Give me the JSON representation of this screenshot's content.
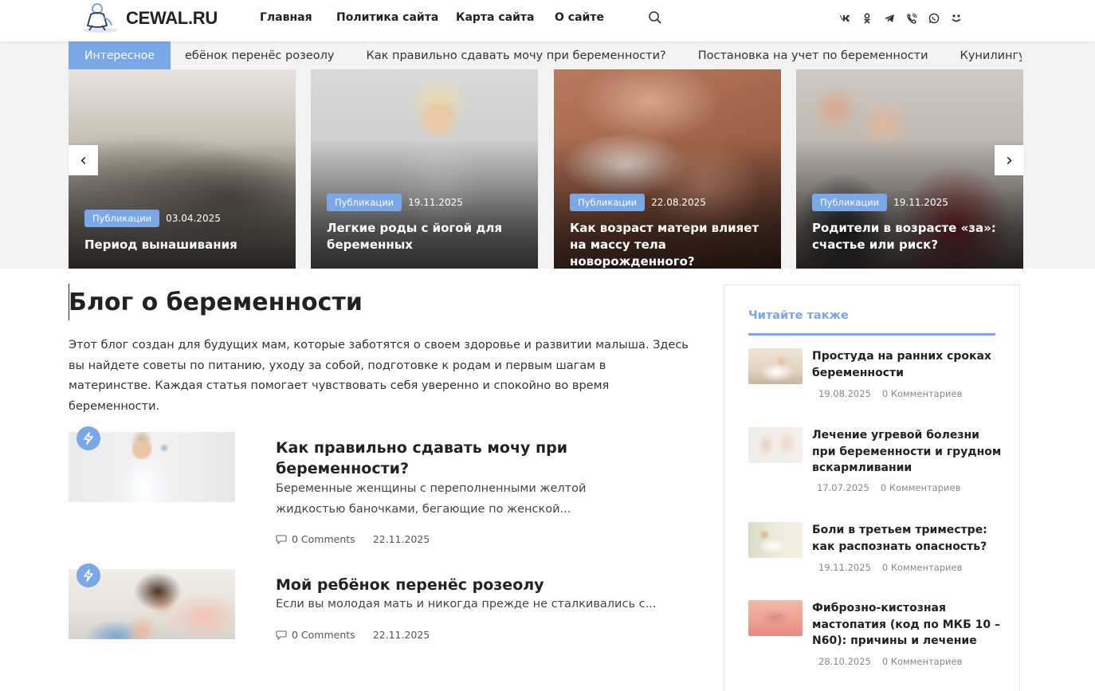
{
  "header": {
    "logo_text": "CEWAL.RU",
    "nav": [
      "Главная",
      "Политика сайта",
      "Карта сайта",
      "О сайте"
    ],
    "social_icons": [
      "vk-icon",
      "odnoklassniki-icon",
      "telegram-icon",
      "viber-icon",
      "whatsapp-icon",
      "moimir-icon"
    ]
  },
  "ticker": {
    "label": "Интересное",
    "items": [
      "ебёнок перенёс розеолу",
      "Как правильно сдавать мочу при беременности?",
      "Постановка на учет по беременности",
      "Кунилингус во"
    ]
  },
  "slider": {
    "cards": [
      {
        "badge": "Публикации",
        "date": "03.04.2025",
        "title": "Период вынашивания"
      },
      {
        "badge": "Публикации",
        "date": "19.11.2025",
        "title": "Легкие роды с йогой для беременных"
      },
      {
        "badge": "Публикации",
        "date": "22.08.2025",
        "title": "Как возраст матери влияет на массу тела новорожденного?"
      },
      {
        "badge": "Публикации",
        "date": "19.11.2025",
        "title": "Родители в возрасте «за»: счастье или риск?"
      }
    ],
    "prev_label": "‹",
    "next_label": "›"
  },
  "main": {
    "title": "Блог о беременности",
    "intro": "Этот блог создан для будущих мам, которые заботятся о своем здоровье и развитии малыша. Здесь вы найдете советы по питанию, уходу за собой, подготовке к родам и первым шагам в материнстве. Каждая статья помогает чувствовать себя уверенно и спокойно во время беременности.",
    "posts": [
      {
        "title": "Как правильно сдавать мочу при беременности?",
        "excerpt": "Беременные женщины с переполненными желтой жидкостью баночками, бегающие по женской...",
        "comments": "0 Comments",
        "date": "22.11.2025"
      },
      {
        "title": "Мой ребёнок перенёс розеолу",
        "excerpt": "Если вы молодая мать и никогда прежде не сталкивались с...",
        "comments": "0 Comments",
        "date": "22.11.2025"
      }
    ]
  },
  "sidebar": {
    "heading": "Читайте также",
    "items": [
      {
        "title": "Простуда на ранних сроках беременности",
        "date": "19.08.2025",
        "comments": "0 Комментариев"
      },
      {
        "title": "Лечение угревой болезни при беременности и грудном вскармливании",
        "date": "17.07.2025",
        "comments": "0 Комментариев"
      },
      {
        "title": "Боли в третьем триместре: как распознать опасность?",
        "date": "19.11.2025",
        "comments": "0 Комментариев"
      },
      {
        "title": "Фиброзно-кистозная мастопатия (код по МКБ 10 – N60): причины и лечение",
        "date": "28.10.2025",
        "comments": "0 Комментариев"
      }
    ]
  },
  "colors": {
    "accent": "#7aa7e8",
    "text": "#222222",
    "band": "#f3f3f3"
  }
}
